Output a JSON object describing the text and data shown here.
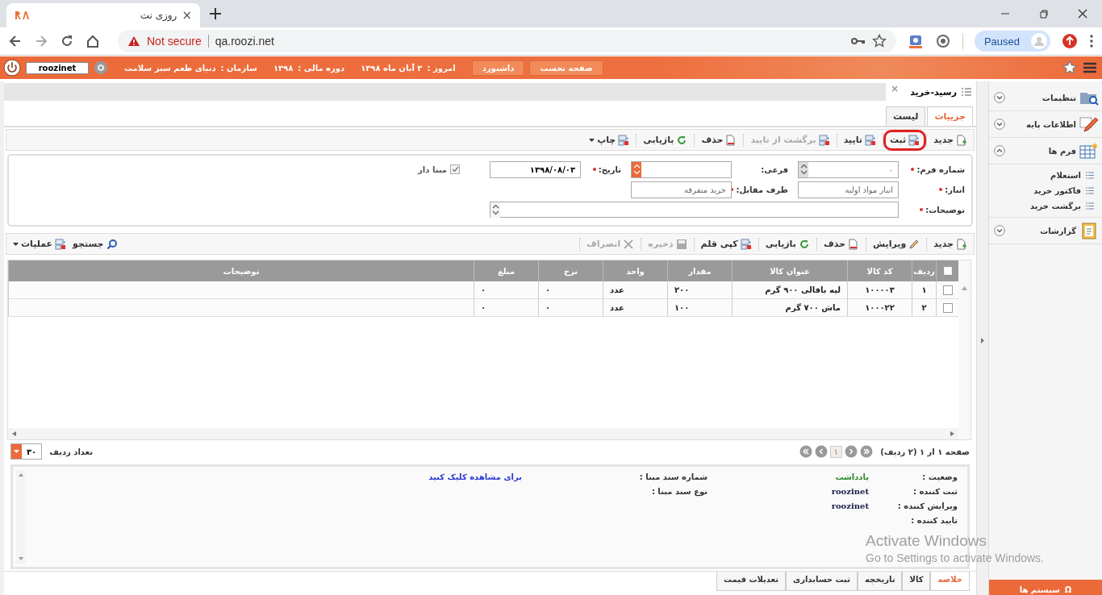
{
  "browser": {
    "tab_title": "روزی نت",
    "tab_close": "×",
    "url_warning": "Not secure",
    "url": "qa.roozi.net",
    "profile": "Paused"
  },
  "header": {
    "user": "roozinet",
    "buttons": [
      "صفحه نخست",
      "داشبورد"
    ],
    "today_label": "امروز :",
    "today": "۳ آبان ماه ۱۳۹۸",
    "year_label": "دوره مالی :",
    "year": "۱۳۹۸",
    "org_label": "سازمان :",
    "org": "دنیای طعم سبز سلامت"
  },
  "doc_tab": {
    "title": "رسید-خرید",
    "close": "×"
  },
  "view_tabs": [
    {
      "label": "جزییات",
      "selected": true
    },
    {
      "label": "لیست",
      "selected": false
    }
  ],
  "toolbar": [
    {
      "label": "جدید",
      "kind": "new",
      "disabled": false,
      "highlighted": false,
      "dropdown": false
    },
    {
      "label": "ثبت",
      "kind": "form",
      "disabled": false,
      "highlighted": true,
      "dropdown": false
    },
    {
      "label": "تایید",
      "kind": "form",
      "disabled": false,
      "highlighted": false,
      "dropdown": false
    },
    {
      "label": "برگشت از تایید",
      "kind": "form",
      "disabled": true,
      "highlighted": false,
      "dropdown": false
    },
    {
      "label": "حذف",
      "kind": "delete",
      "disabled": false,
      "highlighted": false,
      "dropdown": false
    },
    {
      "label": "بازیابی",
      "kind": "refresh",
      "disabled": false,
      "highlighted": false,
      "dropdown": false
    },
    {
      "label": "چاپ",
      "kind": "form",
      "disabled": false,
      "highlighted": false,
      "dropdown": true
    }
  ],
  "form": {
    "rows": [
      [
        {
          "kind": "spin",
          "label": "شماره فرم:",
          "required": true,
          "value": "۰"
        },
        {
          "kind": "spin-accent",
          "label": "فرعی:",
          "required": false
        },
        {
          "kind": "date",
          "label": "تاریخ:",
          "required": true,
          "value": "۱۳۹۸/۰۸/۰۳"
        },
        {
          "kind": "checkbox",
          "label": "مبنا دار",
          "checked": true
        }
      ],
      [
        {
          "kind": "lookup",
          "label": "انبار:",
          "required": true,
          "value": "انبار مواد اولیه"
        },
        {
          "kind": "lookup",
          "label": "طرف مقابل:",
          "required": true,
          "value": "خرید متفرقه"
        }
      ],
      [
        {
          "kind": "memo",
          "label": "توضیحات:",
          "required": true
        }
      ]
    ]
  },
  "grid_toolbar": [
    {
      "label": "جدید",
      "kind": "new",
      "disabled": false
    },
    {
      "label": "ویرایش",
      "kind": "edit",
      "disabled": false
    },
    {
      "label": "حذف",
      "kind": "delete",
      "disabled": false
    },
    {
      "label": "بازیابی",
      "kind": "refresh",
      "disabled": false
    },
    {
      "label": "کپی قلم",
      "kind": "form",
      "disabled": false
    },
    {
      "label": "ذخیره",
      "kind": "save",
      "disabled": true
    },
    {
      "label": "انصراف",
      "kind": "cancel",
      "disabled": true
    }
  ],
  "grid_toolbar_left": [
    {
      "label": "جستجو",
      "kind": "search",
      "dropdown": false
    },
    {
      "label": "عملیات",
      "kind": "form",
      "dropdown": true
    }
  ],
  "table": {
    "all_checked": false,
    "columns": [
      "ردیف",
      "کد کالا",
      "عنوان کالا",
      "مقدار",
      "واحد",
      "نرخ",
      "مبلغ",
      "توضیحات"
    ],
    "rows": [
      {
        "checked": false,
        "cells": [
          "۱",
          "۱۰۰۰۰۳",
          "لپه باقالی ۹۰۰ گرم",
          "۲۰۰",
          "عدد",
          "۰",
          "۰",
          ""
        ]
      },
      {
        "checked": false,
        "cells": [
          "۲",
          "۱۰۰۰۲۲",
          "ماش ۷۰۰ گرم",
          "۱۰۰",
          "عدد",
          "۰",
          "۰",
          ""
        ]
      }
    ]
  },
  "pager": {
    "summary": "صفحه ۱ از ۱ (۲ ردیف)",
    "page": "۱",
    "page_size_label": "تعداد ردیف",
    "page_size": "۳۰"
  },
  "details": {
    "right": [
      {
        "label": "وضعیت :",
        "value": "یادداشت",
        "kind": "status"
      },
      {
        "label": "ثبت کننده :",
        "value": "roozinet",
        "kind": "text"
      },
      {
        "label": "ویرایش کننده :",
        "value": "roozinet",
        "kind": "text"
      },
      {
        "label": "تایید کننده :"
      }
    ],
    "left": [
      {
        "label": "شماره سند مبنا :",
        "value": "برای مشاهده کلیک کنید",
        "kind": "link"
      },
      {
        "label": "نوع سند مبنا :"
      }
    ]
  },
  "bottom_tabs": [
    {
      "label": "خلاصه",
      "selected": true
    },
    {
      "label": "کالا",
      "selected": false
    },
    {
      "label": "تاریخچه",
      "selected": false
    },
    {
      "label": "ثبت حسابداری",
      "selected": false
    },
    {
      "label": "تعدیلات قیمت",
      "selected": false
    }
  ],
  "sidebar": {
    "items": [
      {
        "label": "تنظیمات",
        "kind": "settings",
        "expanded": false
      },
      {
        "label": "اطلاعات پایه",
        "kind": "edit",
        "expanded": false
      },
      {
        "label": "فرم ها",
        "kind": "table",
        "expanded": true,
        "children": [
          "استعلام",
          "فاکتور خرید",
          "برگشت خرید"
        ]
      },
      {
        "label": "گزارشات",
        "kind": "clipboard",
        "expanded": false
      }
    ],
    "systems_button": "سیستم ها",
    "systems_glyph": "Ω"
  },
  "os_notice": {
    "title": "Activate Windows",
    "subtitle": "Go to Settings to activate Windows."
  }
}
